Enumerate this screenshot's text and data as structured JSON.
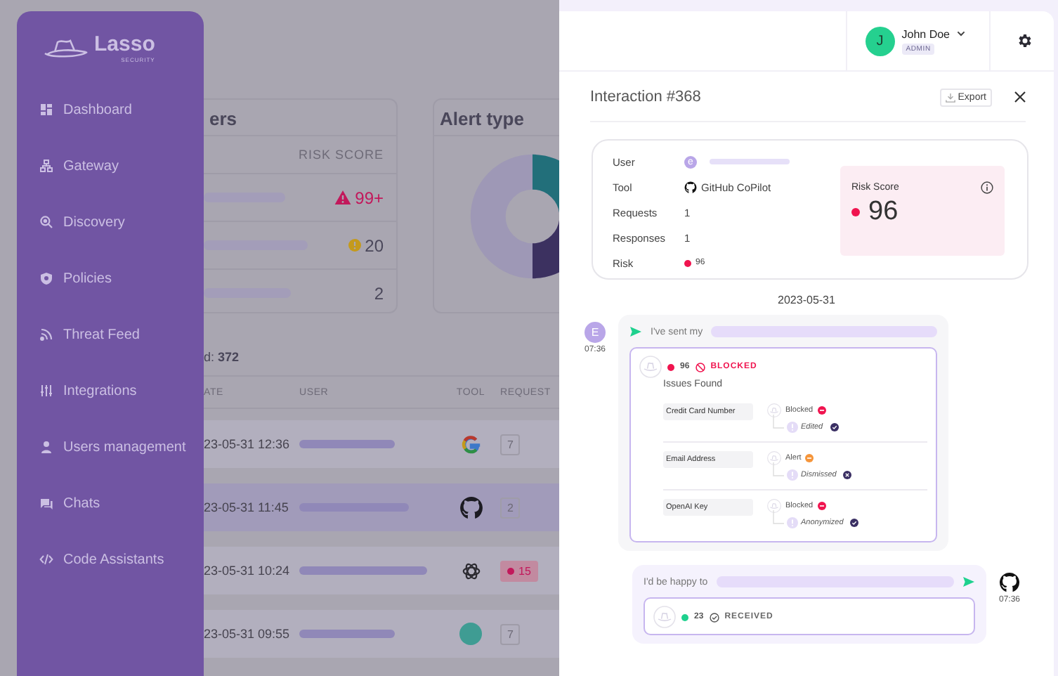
{
  "sidebar": {
    "logo": {
      "name": "Lasso",
      "tagline": "SECURITY"
    },
    "items": [
      {
        "label": "Dashboard"
      },
      {
        "label": "Gateway"
      },
      {
        "label": "Discovery"
      },
      {
        "label": "Policies"
      },
      {
        "label": "Threat Feed"
      },
      {
        "label": "Integrations"
      },
      {
        "label": "Users management"
      },
      {
        "label": "Chats"
      },
      {
        "label": "Code Assistants"
      }
    ]
  },
  "background": {
    "top_users": {
      "title": "ers",
      "column": "RISK SCORE",
      "rows": [
        {
          "score": "99+",
          "kind": "critical"
        },
        {
          "score": "20",
          "kind": "warning"
        },
        {
          "score": "2",
          "kind": "normal"
        }
      ]
    },
    "alert_type": {
      "title": "Alert type"
    },
    "total": "d: **372**",
    "table": {
      "columns": [
        "ATE",
        "USER",
        "TOOL",
        "REQUEST"
      ],
      "rows": [
        {
          "date": "23-05-31 12:36",
          "kind": "google",
          "requests": "7",
          "alert": false,
          "selected": false
        },
        {
          "date": "23-05-31 11:45",
          "kind": "github",
          "requests": "2",
          "alert": false,
          "selected": true
        },
        {
          "date": "23-05-31 10:24",
          "kind": "openai",
          "requests": "15",
          "alert": true,
          "selected": false
        },
        {
          "date": "23-05-31 09:55",
          "kind": "copyai",
          "requests": "7",
          "alert": false,
          "selected": false
        }
      ]
    }
  },
  "header": {
    "user": {
      "initial": "J",
      "name": "John Doe",
      "role": "ADMIN"
    }
  },
  "drawer": {
    "title": "Interaction #368",
    "export": "Export",
    "info": [
      {
        "label": "User",
        "kind": "user",
        "value": "e"
      },
      {
        "label": "Tool",
        "kind": "tool",
        "value": "GitHub CoPilot"
      },
      {
        "label": "Requests",
        "kind": "text",
        "value": "1"
      },
      {
        "label": "Responses",
        "kind": "text",
        "value": "1"
      },
      {
        "label": "Risk",
        "kind": "risk",
        "value": "96",
        "color": "#f0144f"
      }
    ],
    "risk_score": {
      "label": "Risk Score",
      "value": "96",
      "color": "#f0144f"
    },
    "date": "2023-05-31",
    "messages": [
      {
        "kind": "prompt",
        "avatar": "E",
        "time": "07:36",
        "text": "I've sent my",
        "result": {
          "score": "96",
          "color": "#f0144f",
          "status": "BLOCKED",
          "kind": "blocked",
          "heading": "Issues Found",
          "issues": [
            {
              "label": "Credit Card Number",
              "action": {
                "label": "Blocked",
                "kind": "blocked"
              },
              "resolution": {
                "label": "Edited",
                "kind": "check"
              }
            },
            {
              "label": "Email Address",
              "action": {
                "label": "Alert",
                "kind": "alert"
              },
              "resolution": {
                "label": "Dismissed",
                "kind": "dismiss"
              }
            },
            {
              "label": "OpenAI Key",
              "action": {
                "label": "Blocked",
                "kind": "blocked"
              },
              "resolution": {
                "label": "Anonymized",
                "kind": "check"
              }
            }
          ]
        }
      },
      {
        "kind": "response",
        "time": "07:36",
        "text": "I'd be happy to",
        "result": {
          "score": "23",
          "color": "#1ed18e",
          "status": "RECEIVED",
          "kind": "received"
        }
      }
    ]
  }
}
